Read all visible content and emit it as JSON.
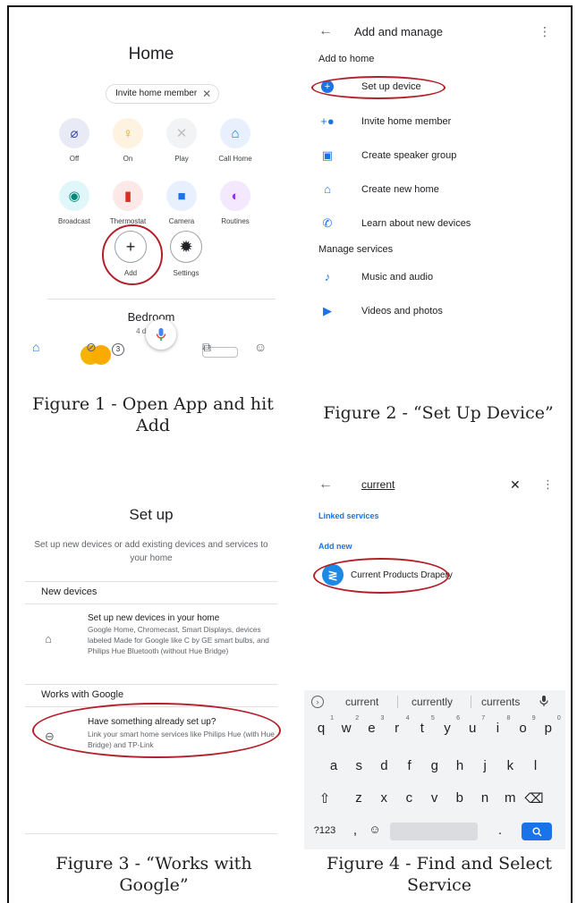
{
  "figure1": {
    "screen": {
      "title": "Home",
      "chip_label": "Invite home member",
      "chip_close": "✕",
      "actions": [
        {
          "label": "Off",
          "icon": "light-off-icon",
          "glyph": "⌀",
          "bg": "#e8eaf6",
          "fg": "#3949ab"
        },
        {
          "label": "On",
          "icon": "lightbulb-icon",
          "glyph": "♀",
          "bg": "#fef3e0",
          "fg": "#f29900"
        },
        {
          "label": "Play",
          "icon": "play-disabled-icon",
          "glyph": "✕",
          "bg": "#f1f3f4",
          "fg": "#bdc1c6"
        },
        {
          "label": "Call Home",
          "icon": "call-home-icon",
          "glyph": "⌂",
          "bg": "#e8f0fe",
          "fg": "#1a73e8"
        },
        {
          "label": "Broadcast",
          "icon": "broadcast-icon",
          "glyph": "◉",
          "bg": "#e0f7fa",
          "fg": "#00897b"
        },
        {
          "label": "Thermostat",
          "icon": "thermostat-icon",
          "glyph": "▮",
          "bg": "#fce8e6",
          "fg": "#d93025"
        },
        {
          "label": "Camera",
          "icon": "camera-icon",
          "glyph": "■",
          "bg": "#e8f0fe",
          "fg": "#1a73e8"
        },
        {
          "label": "Routines",
          "icon": "routines-icon",
          "glyph": "◐",
          "bg": "#f3e8fd",
          "fg": "#9334e6"
        }
      ],
      "add_label": "Add",
      "add_glyph": "+",
      "settings_label": "Settings",
      "settings_glyph": "✹",
      "room_name": "Bedroom",
      "room_devices": "4 devices",
      "device_badge": "3"
    },
    "caption": "Figure 1 - Open App and hit Add"
  },
  "figure2": {
    "screen": {
      "title": "Add and manage",
      "section_add": "Add to home",
      "add_items": [
        {
          "label": "Set up device",
          "icon": "add-circle-icon",
          "glyph": "+"
        },
        {
          "label": "Invite home member",
          "icon": "person-add-icon",
          "glyph": "+●"
        },
        {
          "label": "Create speaker group",
          "icon": "speaker-icon",
          "glyph": "▣"
        },
        {
          "label": "Create new home",
          "icon": "home-icon",
          "glyph": "⌂"
        },
        {
          "label": "Learn about new devices",
          "icon": "phone-icon",
          "glyph": "✆"
        }
      ],
      "section_manage": "Manage services",
      "manage_items": [
        {
          "label": "Music and audio",
          "icon": "music-note-icon",
          "glyph": "♪"
        },
        {
          "label": "Videos and photos",
          "icon": "video-icon",
          "glyph": "▶"
        }
      ]
    },
    "caption": "Figure 2 - “Set Up Device”"
  },
  "figure3": {
    "screen": {
      "title": "Set up",
      "subtitle": "Set up new devices or add existing devices and services to your home",
      "section_new": "New devices",
      "new_title": "Set up new devices in your home",
      "new_desc": "Google Home, Chromecast, Smart Displays, devices labeled Made for Google like C by GE smart bulbs, and Philips Hue Bluetooth (without Hue Bridge)",
      "section_works": "Works with Google",
      "works_title": "Have something already set up?",
      "works_desc": "Link your smart home services like Philips Hue (with Hue Bridge) and TP-Link"
    },
    "caption": "Figure 3 - “Works with Google”"
  },
  "figure4": {
    "screen": {
      "query": "current",
      "linked_label": "Linked services",
      "add_new_label": "Add new",
      "result_name": "Current Products Drapery",
      "logo_glyph": "≷",
      "suggestions": [
        "current",
        "currently",
        "currents"
      ],
      "row1": [
        {
          "k": "q",
          "n": "1"
        },
        {
          "k": "w",
          "n": "2"
        },
        {
          "k": "e",
          "n": "3"
        },
        {
          "k": "r",
          "n": "4"
        },
        {
          "k": "t",
          "n": "5"
        },
        {
          "k": "y",
          "n": "6"
        },
        {
          "k": "u",
          "n": "7"
        },
        {
          "k": "i",
          "n": "8"
        },
        {
          "k": "o",
          "n": "9"
        },
        {
          "k": "p",
          "n": "0"
        }
      ],
      "row2": [
        "a",
        "s",
        "d",
        "f",
        "g",
        "h",
        "j",
        "k",
        "l"
      ],
      "row3": [
        "z",
        "x",
        "c",
        "v",
        "b",
        "n",
        "m"
      ],
      "shift_glyph": "⇧",
      "backspace_glyph": "⌫",
      "sym_label": "?123",
      "comma_label": ",",
      "emoji_glyph": "☺",
      "period_label": ".",
      "enter_glyph": "⌕",
      "mic_glyph": "🎙"
    },
    "caption": "Figure 4 - Find and Select Service"
  },
  "colors": {
    "accent_blue": "#1a73e8",
    "highlight_red": "#b3202a"
  }
}
